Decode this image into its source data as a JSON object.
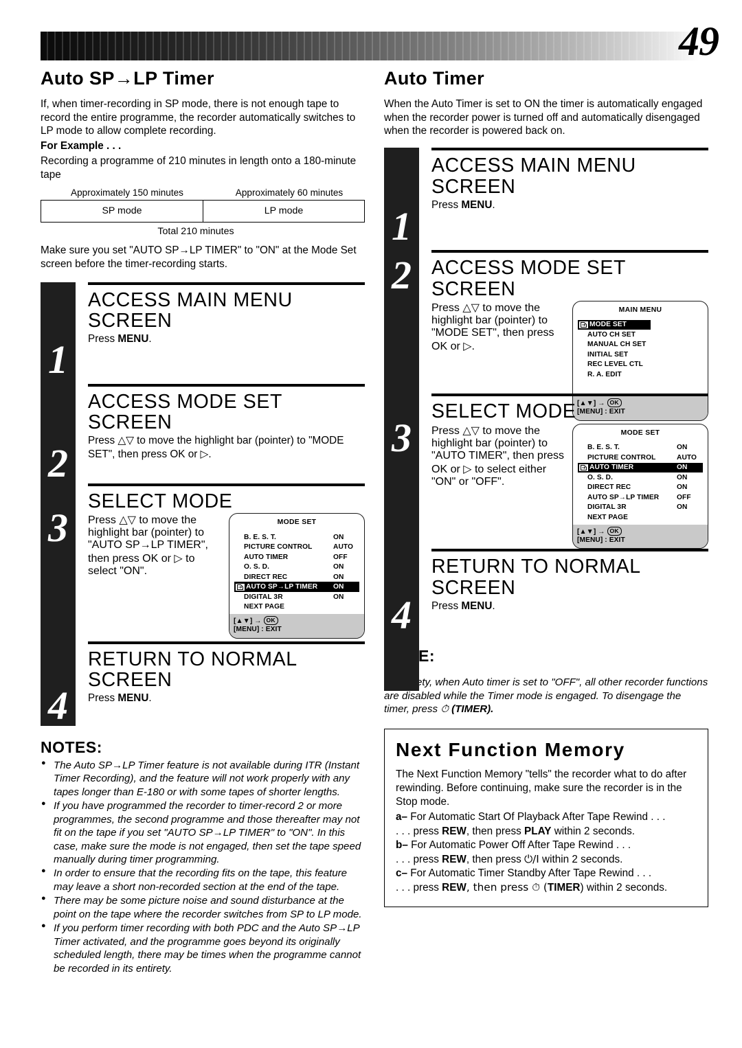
{
  "page": {
    "number": "49"
  },
  "left": {
    "section_title": "Auto SP→LP Timer",
    "intro": "If, when timer-recording in SP mode, there is not enough tape to record the entire programme, the recorder automatically switches to LP mode to allow complete recording.",
    "for_example_label": "For Example . . .",
    "example_text": "Recording a programme of 210 minutes in length onto a 180-minute tape",
    "table": {
      "label_left": "Approximately 150 minutes",
      "label_right": "Approximately 60 minutes",
      "cell_left": "SP mode",
      "cell_right": "LP mode",
      "total": "Total 210 minutes"
    },
    "make_sure": "Make sure you set \"AUTO SP→LP TIMER\" to \"ON\" at the Mode Set screen before the timer-recording starts.",
    "steps": [
      {
        "num": "1",
        "title": "ACCESS MAIN MENU SCREEN",
        "desc_pre": "Press ",
        "desc_bold": "MENU",
        "desc_post": "."
      },
      {
        "num": "2",
        "title": "ACCESS MODE SET SCREEN",
        "desc": "Press △▽ to move the highlight bar (pointer) to \"MODE SET\", then press OK or ▷."
      },
      {
        "num": "3",
        "title": "SELECT MODE",
        "desc": "Press △▽ to move the highlight bar (pointer) to \"AUTO SP→LP TIMER\", then press OK or ▷ to select \"ON\"."
      },
      {
        "num": "4",
        "title": "RETURN TO NORMAL SCREEN",
        "desc_pre": "Press ",
        "desc_bold": "MENU",
        "desc_post": "."
      }
    ],
    "osd_mode_set": {
      "title": "MODE SET",
      "rows": [
        {
          "name": "B. E. S. T.",
          "value": "ON",
          "selected": false
        },
        {
          "name": "PICTURE CONTROL",
          "value": "AUTO",
          "selected": false
        },
        {
          "name": "AUTO TIMER",
          "value": "OFF",
          "selected": false
        },
        {
          "name": "O. S. D.",
          "value": "ON",
          "selected": false
        },
        {
          "name": "DIRECT REC",
          "value": "ON",
          "selected": false
        },
        {
          "name": "AUTO SP→LP TIMER",
          "value": "ON",
          "selected": true
        },
        {
          "name": "DIGITAL 3R",
          "value": "ON",
          "selected": false
        },
        {
          "name": "NEXT PAGE",
          "value": "",
          "selected": false
        }
      ],
      "foot_line1_keys": "[▲▼]",
      "foot_line1_arrow": "→",
      "foot_line1_ok": "OK",
      "foot_line2": "[MENU] : EXIT"
    },
    "notes_heading": "NOTES:",
    "notes": [
      "The Auto SP→LP Timer feature is not available during ITR (Instant Timer Recording), and the feature will not work properly with any tapes longer than E-180 or with some tapes of shorter lengths.",
      "If you have programmed the recorder to timer-record 2 or more programmes, the second programme and those thereafter may not fit on the tape if you set \"AUTO SP→LP TIMER\" to \"ON\". In this case, make sure the mode is not engaged, then set the tape speed manually during timer programming.",
      "In order to ensure that the recording fits on the tape, this feature may leave a short non-recorded section at the end of the tape.",
      "There may be some picture noise and sound disturbance at the point on the tape where the recorder switches from SP to LP mode.",
      "If you perform timer recording with both PDC and the Auto SP→LP Timer activated, and the programme goes beyond its originally scheduled length, there may be times when the programme cannot be recorded in its entirety."
    ]
  },
  "right": {
    "section_title": "Auto Timer",
    "intro": "When the Auto Timer is set to ON the timer is automatically engaged when the recorder power is turned off and automatically disengaged when the recorder is powered back on.",
    "steps": [
      {
        "num": "1",
        "title": "ACCESS MAIN MENU SCREEN",
        "desc_pre": "Press ",
        "desc_bold": "MENU",
        "desc_post": "."
      },
      {
        "num": "2",
        "title": "ACCESS MODE SET SCREEN",
        "desc": "Press △▽ to move the highlight bar (pointer) to \"MODE SET\", then press OK or ▷."
      },
      {
        "num": "3",
        "title": "SELECT MODE",
        "desc": "Press △▽ to move the highlight bar (pointer) to \"AUTO TIMER\", then press OK or ▷ to select either \"ON\" or \"OFF\"."
      },
      {
        "num": "4",
        "title": "RETURN TO NORMAL SCREEN",
        "desc_pre": "Press ",
        "desc_bold": "MENU",
        "desc_post": "."
      }
    ],
    "osd_main_menu": {
      "title": "MAIN MENU",
      "rows": [
        {
          "name": "MODE SET",
          "value": "",
          "selected": true
        },
        {
          "name": "AUTO CH SET",
          "value": "",
          "selected": false
        },
        {
          "name": "MANUAL CH SET",
          "value": "",
          "selected": false
        },
        {
          "name": "INITIAL SET",
          "value": "",
          "selected": false
        },
        {
          "name": "REC LEVEL CTL",
          "value": "",
          "selected": false
        },
        {
          "name": "R. A. EDIT",
          "value": "",
          "selected": false
        }
      ],
      "foot_line1_keys": "[▲▼]",
      "foot_line1_arrow": "→",
      "foot_line1_ok": "OK",
      "foot_line2": "[MENU] : EXIT"
    },
    "osd_mode_set": {
      "title": "MODE SET",
      "rows": [
        {
          "name": "B. E. S. T.",
          "value": "ON",
          "selected": false
        },
        {
          "name": "PICTURE CONTROL",
          "value": "AUTO",
          "selected": false
        },
        {
          "name": "AUTO TIMER",
          "value": "ON",
          "selected": true
        },
        {
          "name": "O. S. D.",
          "value": "ON",
          "selected": false
        },
        {
          "name": "DIRECT REC",
          "value": "ON",
          "selected": false
        },
        {
          "name": "AUTO SP→LP TIMER",
          "value": "OFF",
          "selected": false
        },
        {
          "name": "DIGITAL 3R",
          "value": "ON",
          "selected": false
        },
        {
          "name": "NEXT PAGE",
          "value": "",
          "selected": false
        }
      ],
      "foot_line1_keys": "[▲▼]",
      "foot_line1_arrow": "→",
      "foot_line1_ok": "OK",
      "foot_line2": "[MENU] : EXIT"
    },
    "note_heading": "NOTE:",
    "note_text_pre": "For safety, when Auto timer is set to \"OFF\", all other recorder functions are disabled while the Timer mode is engaged. To disengage the timer, press ",
    "note_icon": "⏱",
    "note_text_post": " (TIMER).",
    "nfm": {
      "title": "Next Function Memory",
      "intro": "The Next Function Memory \"tells\" the recorder what to do after rewinding. Before continuing, make sure the recorder is in the Stop mode.",
      "items": [
        {
          "lead": "a–",
          "head": " For Automatic Start Of Playback After Tape Rewind . . .",
          "sub_pre": ". . . press ",
          "sub_key1": "REW",
          "sub_mid": ", then press ",
          "sub_key2": "PLAY",
          "sub_post": " within 2 seconds."
        },
        {
          "lead": "b–",
          "head": " For Automatic Power Off After Tape Rewind . . .",
          "sub_pre": ". . . press ",
          "sub_key1": "REW",
          "sub_mid": ", then press ",
          "sub_key2": "⏻/I",
          "sub_post": " within 2 seconds."
        },
        {
          "lead": "c–",
          "head": " For Automatic Timer Standby After Tape Rewind . . .",
          "sub_pre": ". . . press ",
          "sub_key1": "REW",
          "sub_mid": ", then press ⏱ (",
          "sub_key2": "TIMER",
          "sub_post": ") within 2 seconds."
        }
      ]
    }
  }
}
